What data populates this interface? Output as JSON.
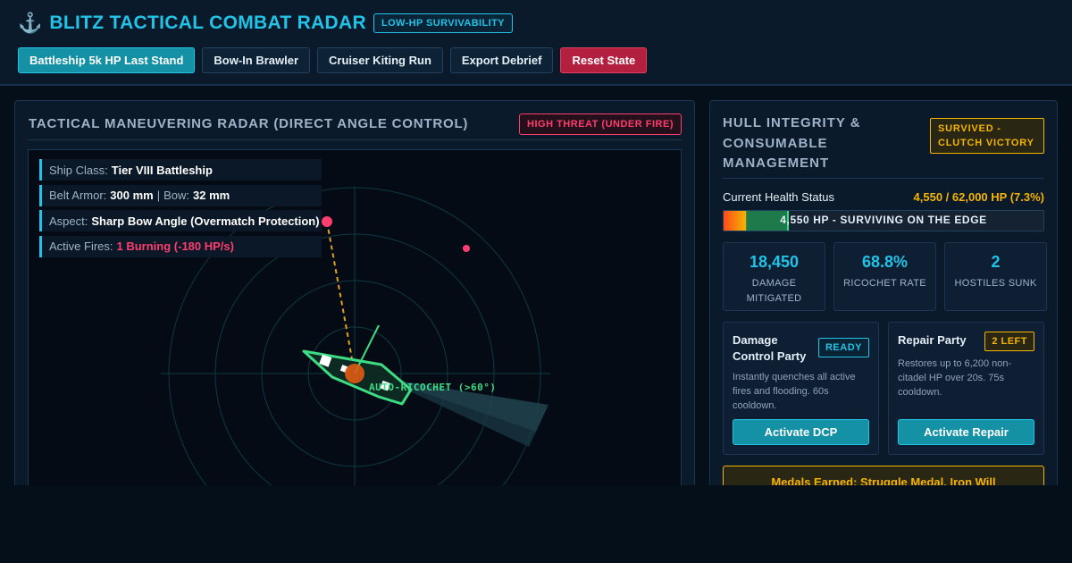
{
  "header": {
    "icon": "anchor-icon",
    "icon_glyph": "⚓",
    "title": "BLITZ TACTICAL COMBAT RADAR",
    "badge": "LOW-HP SURVIVABILITY",
    "buttons": [
      {
        "label": "Battleship 5k HP Last Stand",
        "state": "active"
      },
      {
        "label": "Bow-In Brawler",
        "state": "normal"
      },
      {
        "label": "Cruiser Kiting Run",
        "state": "normal"
      },
      {
        "label": "Export Debrief",
        "state": "normal"
      },
      {
        "label": "Reset State",
        "state": "danger"
      }
    ]
  },
  "radar_panel": {
    "title": "TACTICAL MANEUVERING RADAR (DIRECT ANGLE CONTROL)",
    "threat_badge": "HIGH THREAT (UNDER FIRE)",
    "info": {
      "ship_class_label": "Ship Class:",
      "ship_class": "Tier VIII Battleship",
      "belt_label": "Belt Armor:",
      "belt_value": "300 mm",
      "bow_label": "Bow:",
      "bow_value": "32 mm",
      "aspect_label": "Aspect:",
      "aspect_value": "Sharp Bow Angle (Overmatch Protection)",
      "fires_label": "Active Fires:",
      "fires_value": "1 Burning (-180 HP/s)"
    },
    "ricochet_label": "AUTO-RICOCHET (>60°)"
  },
  "hull_panel": {
    "title": "HULL INTEGRITY & CONSUMABLE MANAGEMENT",
    "outcome_badge": "SURVIVED - CLUTCH VICTORY",
    "hp_label": "Current Health Status",
    "hp_value": "4,550 / 62,000 HP (7.3%)",
    "hp_fraction": 0.073,
    "hp_bar_text": "4,550 HP - SURVIVING ON THE EDGE",
    "stats": [
      {
        "value": "18,450",
        "label": "DAMAGE MITIGATED"
      },
      {
        "value": "68.8%",
        "label": "RICOCHET RATE"
      },
      {
        "value": "2",
        "label": "HOSTILES SUNK"
      }
    ],
    "consumables": {
      "dcp": {
        "name": "Damage Control Party",
        "badge": "READY",
        "description": "Instantly quenches all active fires and flooding. 60s cooldown.",
        "button": "Activate DCP"
      },
      "repair": {
        "name": "Repair Party",
        "badge": "2 LEFT",
        "description": "Restores up to 6,200 non-citadel HP over 20s. 75s cooldown.",
        "button": "Activate Repair"
      }
    },
    "medals": "Medals Earned: Struggle Medal, Iron Will"
  },
  "colors": {
    "accent": "#22c3e6",
    "danger": "#ff3d6e",
    "warning": "#f4b400",
    "success": "#3ddc84"
  }
}
